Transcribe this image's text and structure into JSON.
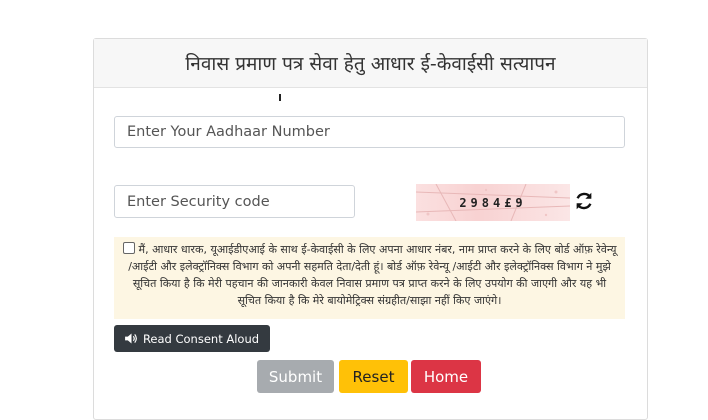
{
  "header": {
    "title": "निवास प्रमाण पत्र सेवा हेतु आधार ई-केवाईसी सत्यापन"
  },
  "form": {
    "aadhaar_placeholder": "Enter Your Aadhaar Number",
    "security_placeholder": "Enter Security code",
    "captcha_text": "2984£9",
    "refresh_icon": "refresh-icon"
  },
  "consent": {
    "text": "मैं, आधार धारक, यूआईडीएआई के साथ ई-केवाईसी के लिए अपना आधार नंबर, नाम प्राप्त करने के लिए बोर्ड ऑफ़ रेवेन्यू /आईटी और इलेक्ट्रॉनिक्स विभाग को अपनी सहमति देता/देती हूं। बोर्ड ऑफ़ रेवेन्यू /आईटी और इलेक्ट्रॉनिक्स विभाग ने मुझे सूचित किया है कि मेरी पहचान की जानकारी केवल निवास प्रमाण पत्र प्राप्त करने के लिए उपयोग की जाएगी और यह भी सूचित किया है कि मेरे बायोमेट्रिक्स संग्रहीत/साझा नहीं किए जाएंगे।",
    "checked": false,
    "read_button_label": "Read Consent Aloud"
  },
  "buttons": {
    "submit": "Submit",
    "reset": "Reset",
    "home": "Home"
  },
  "colors": {
    "submit": "#a7abaf",
    "reset": "#ffc107",
    "home": "#dc3545",
    "read_button": "#343a40",
    "consent_bg": "#fdf6e3"
  }
}
